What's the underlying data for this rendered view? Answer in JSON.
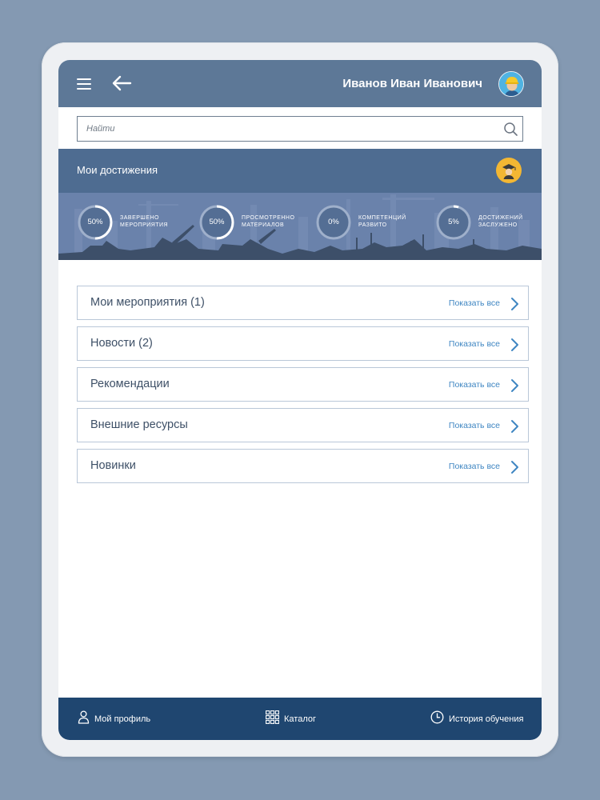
{
  "header": {
    "user_name": "Иванов Иван Иванович",
    "menu_icon": "hamburger-menu-icon",
    "back_icon": "arrow-left-icon",
    "avatar_icon": "worker-avatar"
  },
  "search": {
    "placeholder": "Найти",
    "value": "",
    "icon": "search-icon"
  },
  "achievements": {
    "title": "Мои достижения",
    "badge_icon": "graduate-icon",
    "stats": [
      {
        "value": "50%",
        "progress": 0.5,
        "label_line1": "Завершено",
        "label_line2": "мероприятия"
      },
      {
        "value": "50%",
        "progress": 0.5,
        "label_line1": "Просмотренно",
        "label_line2": "материалов"
      },
      {
        "value": "0%",
        "progress": 0.0,
        "label_line1": "Компетенций",
        "label_line2": "развито"
      },
      {
        "value": "5%",
        "progress": 0.05,
        "label_line1": "Достижений",
        "label_line2": "заслужено"
      }
    ]
  },
  "sections": [
    {
      "title": "Мои мероприятия (1)",
      "link": "Показать все"
    },
    {
      "title": "Новости (2)",
      "link": "Показать все"
    },
    {
      "title": "Рекомендации",
      "link": "Показать все"
    },
    {
      "title": "Внешние ресурсы",
      "link": "Показать все"
    },
    {
      "title": "Новинки",
      "link": "Показать все"
    }
  ],
  "bottom_nav": {
    "profile": {
      "label": "Мой профиль",
      "icon": "person-icon"
    },
    "catalog": {
      "label": "Каталог",
      "icon": "grid-icon"
    },
    "history": {
      "label": "История обучения",
      "icon": "clock-icon"
    }
  },
  "colors": {
    "topbar": "#5d7897",
    "achievements_header": "#4e6c91",
    "achievements_band": "#6a82ab",
    "bottom_bar": "#1f4670",
    "link": "#3f86c2",
    "ring_progress": "#ffffff",
    "ring_track": "#9fb0cb"
  }
}
